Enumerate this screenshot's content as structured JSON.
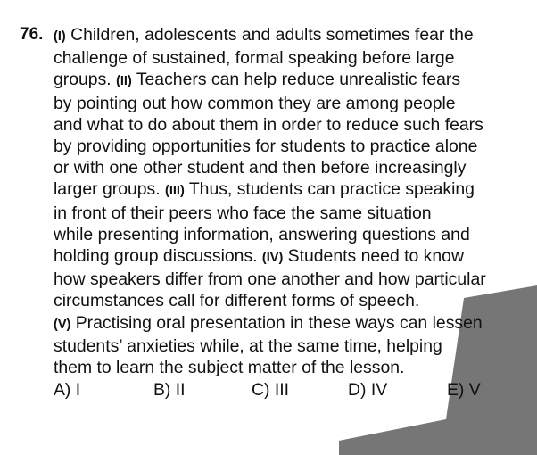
{
  "question": {
    "number": "76.",
    "lines": [
      [
        {
          "mark": "(I)",
          "text": " Children, adolescents and adults sometimes fear the"
        }
      ],
      [
        {
          "text": "challenge of sustained, formal speaking before large"
        }
      ],
      [
        {
          "text": "groups. "
        },
        {
          "mark": "(II)",
          "text": " Teachers can help reduce unrealistic fears"
        }
      ],
      [
        {
          "text": "by pointing out how common they are among people"
        }
      ],
      [
        {
          "text": "and what to do about them in order to reduce such fears"
        }
      ],
      [
        {
          "text": "by providing opportunities for students to practice alone"
        }
      ],
      [
        {
          "text": "or with one other student and then before increasingly"
        }
      ],
      [
        {
          "text": "larger groups. "
        },
        {
          "mark": "(III)",
          "text": " Thus, students can practice speaking"
        }
      ],
      [
        {
          "text": "in front of their peers who face the same situation"
        }
      ],
      [
        {
          "text": "while presenting information, answering questions and"
        }
      ],
      [
        {
          "text": "holding group discussions. "
        },
        {
          "mark": "(IV)",
          "text": " Students need to know"
        }
      ],
      [
        {
          "text": "how speakers differ from one another and how particular"
        }
      ],
      [
        {
          "text": "circumstances call for different forms of speech."
        }
      ],
      [
        {
          "mark": "(V)",
          "text": " Practising oral presentation in these ways can lessen"
        }
      ],
      [
        {
          "text": "students’ anxieties while, at the same time, helping"
        }
      ],
      [
        {
          "text": "them to learn the subject matter of the lesson."
        }
      ]
    ],
    "options": [
      {
        "label": "A) I"
      },
      {
        "label": "B) II"
      },
      {
        "label": "C) III"
      },
      {
        "label": "D) IV"
      },
      {
        "label": "E) V"
      }
    ]
  },
  "colors": {
    "text": "#111111",
    "watermark": "#6f6f6f"
  }
}
